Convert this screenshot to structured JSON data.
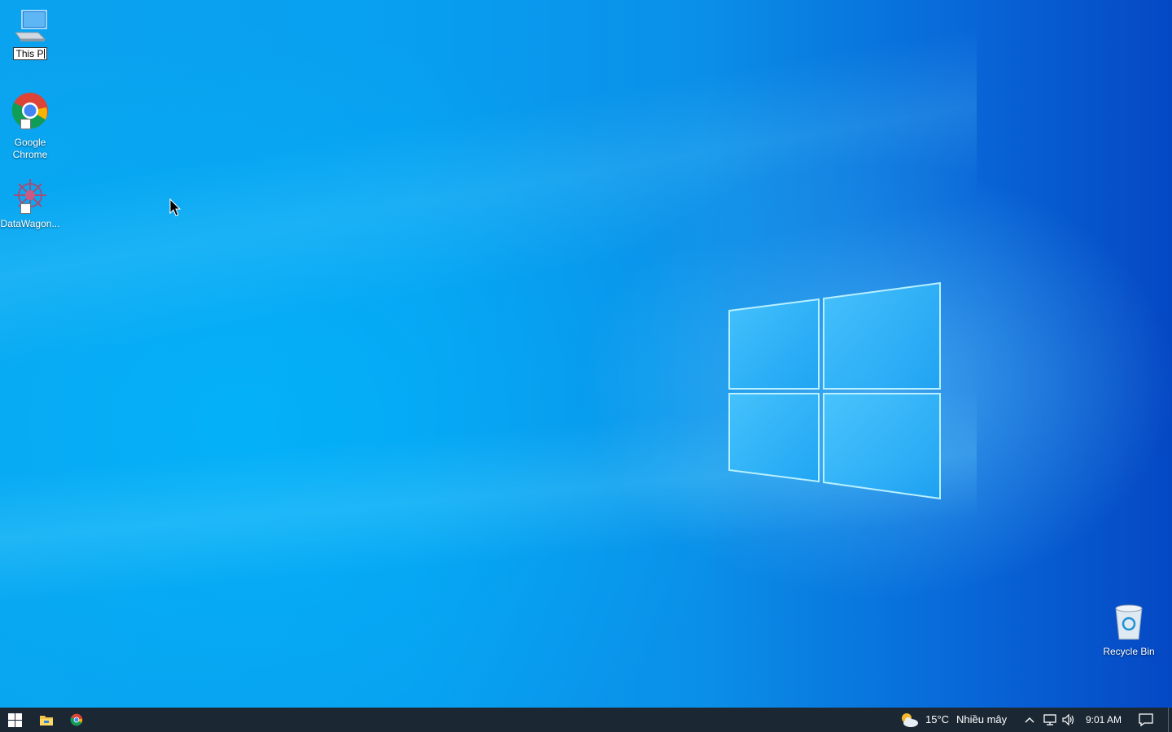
{
  "desktop": {
    "icons": [
      {
        "name": "This PC",
        "rename_value": "This P",
        "renaming": true
      },
      {
        "name": "Google Chrome",
        "label_line1": "Google",
        "label_line2": "Chrome"
      },
      {
        "name": "DataWagon...",
        "label": "DataWagon..."
      },
      {
        "name": "Recycle Bin",
        "label": "Recycle Bin"
      }
    ]
  },
  "taskbar": {
    "start_icon": "windows-start-icon",
    "pinned": [
      {
        "name": "file-explorer-icon"
      },
      {
        "name": "chrome-icon"
      }
    ],
    "weather": {
      "temperature": "15°C",
      "condition": "Nhiều mây",
      "icon": "partly-cloudy-icon"
    },
    "tray_icons": [
      "chevron-up-icon",
      "network-icon",
      "volume-icon"
    ],
    "clock": "9:01 AM",
    "notification_icon": "action-center-icon"
  },
  "colors": {
    "taskbar_bg": "#1b2733",
    "wallpaper_light": "#0aa3ef",
    "wallpaper_dark": "#0548c4"
  }
}
